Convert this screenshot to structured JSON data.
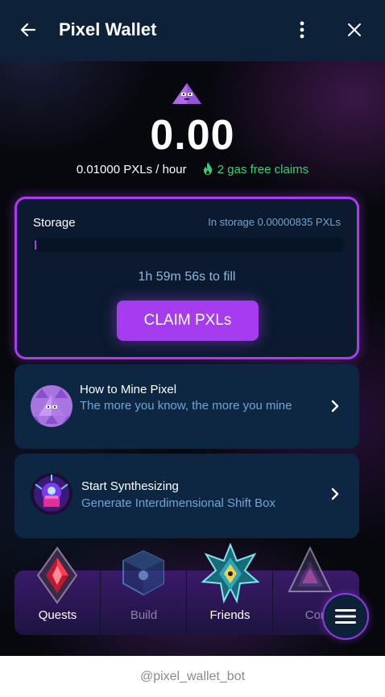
{
  "header": {
    "title": "Pixel Wallet",
    "back_icon": "back-arrow-icon",
    "more_icon": "more-vertical-icon",
    "close_icon": "close-icon"
  },
  "balance": {
    "value": "0.00",
    "rate": "0.01000 PXLs / hour",
    "gas_free": "2 gas free claims"
  },
  "storage": {
    "label": "Storage",
    "amount": "In storage 0.00000835 PXLs",
    "progress": 0.005,
    "fill_time": "1h 59m 56s to fill",
    "claim_label": "CLAIM PXLs"
  },
  "cards": [
    {
      "title": "How to Mine Pixel",
      "subtitle": "The more you know, the more you mine",
      "icon": "pixel-mascot-icon"
    },
    {
      "title": "Start Synthesizing",
      "subtitle": "Generate Interdimensional Shift Box",
      "icon": "synthesis-box-icon"
    }
  ],
  "nav": {
    "items": [
      {
        "label": "Quests",
        "icon": "quests-crystal-icon",
        "active": true
      },
      {
        "label": "Build",
        "icon": "build-cube-icon",
        "active": false
      },
      {
        "label": "Friends",
        "icon": "friends-star-icon",
        "active": true
      },
      {
        "label": "Con",
        "icon": "triangle-crystal-icon",
        "active": false
      }
    ],
    "menu_icon": "hamburger-menu-icon"
  },
  "footer": {
    "bot_name": "@pixel_wallet_bot"
  },
  "colors": {
    "accent": "#a93cf0",
    "gas_green": "#33d17a",
    "muted_blue": "#6fa6d6",
    "header_bg": "#0d2238"
  }
}
